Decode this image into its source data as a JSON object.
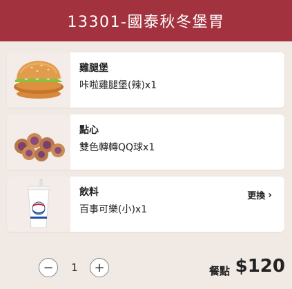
{
  "header": {
    "title": "13301-國泰秋冬堡胃"
  },
  "items": [
    {
      "category": "雞腿堡",
      "desc": "咔啦雞腿堡(辣)x1",
      "icon": "chicken-burger-image"
    },
    {
      "category": "點心",
      "desc": "雙色轉轉QQ球x1",
      "icon": "qq-balls-image"
    },
    {
      "category": "飲料",
      "desc": "百事可樂(小)x1",
      "icon": "pepsi-cup-image",
      "action_label": "更換"
    }
  ],
  "footer": {
    "minus_label": "−",
    "quantity": "1",
    "plus_label": "+",
    "price_label": "餐點",
    "price": "$120"
  },
  "colors": {
    "header_bg": "#a3323f",
    "page_bg": "#f1e9e3"
  }
}
